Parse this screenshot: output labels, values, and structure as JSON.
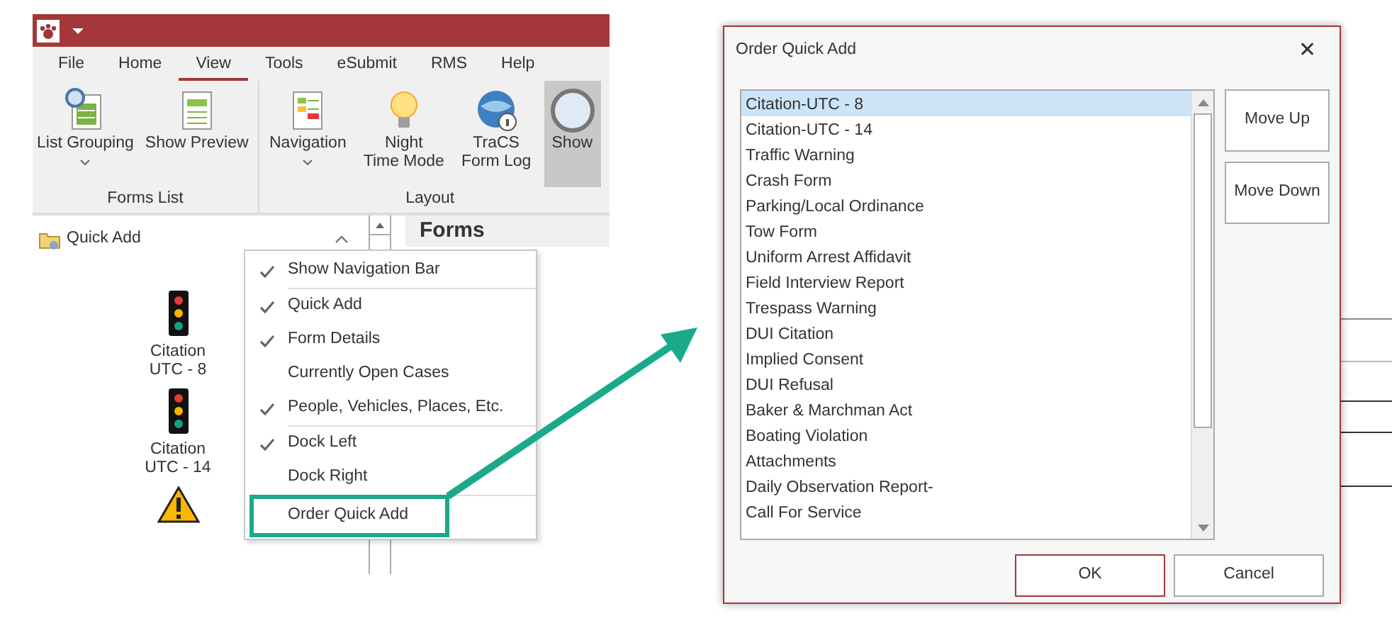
{
  "app": {
    "tabs": [
      {
        "label": "File",
        "selected": false
      },
      {
        "label": "Home",
        "selected": false
      },
      {
        "label": "View",
        "selected": true
      },
      {
        "label": "Tools",
        "selected": false
      },
      {
        "label": "eSubmit",
        "selected": false
      },
      {
        "label": "RMS",
        "selected": false
      },
      {
        "label": "Help",
        "selected": false
      }
    ],
    "ribbon_groups": [
      {
        "label": "Forms List",
        "buttons": [
          {
            "label": "List Grouping",
            "kind": "grouping",
            "dropdown": true,
            "pressed": false
          },
          {
            "label": "Show Preview",
            "kind": "preview",
            "dropdown": false,
            "pressed": false
          }
        ]
      },
      {
        "label": "Layout",
        "buttons": [
          {
            "label": "Navigation",
            "kind": "navigation",
            "dropdown": true,
            "pressed": false
          },
          {
            "label": "Night\nTime Mode",
            "kind": "bulb",
            "dropdown": false,
            "pressed": false
          },
          {
            "label": "TraCS\nForm Log",
            "kind": "globe",
            "dropdown": false,
            "pressed": false
          },
          {
            "label": "Show",
            "kind": "magnifier",
            "dropdown": false,
            "pressed": true
          }
        ]
      }
    ],
    "panel": {
      "title": "Quick Add",
      "items": [
        {
          "kind": "signal",
          "label": "Citation\nUTC - 8"
        },
        {
          "kind": "signal",
          "label": "Citation\nUTC - 14"
        },
        {
          "kind": "warning"
        }
      ]
    },
    "forms_header": "Forms",
    "context_menu": {
      "groups": [
        [
          {
            "label": "Show Navigation Bar",
            "checked": true,
            "callout": false
          }
        ],
        [
          {
            "label": "Quick Add",
            "checked": true,
            "callout": false
          },
          {
            "label": "Form Details",
            "checked": true,
            "callout": false
          },
          {
            "label": "Currently Open Cases",
            "checked": false,
            "callout": false
          },
          {
            "label": "People, Vehicles, Places, Etc.",
            "checked": true,
            "callout": false
          }
        ],
        [
          {
            "label": "Dock Left",
            "checked": true,
            "callout": false
          },
          {
            "label": "Dock Right",
            "checked": false,
            "callout": false
          }
        ],
        [
          {
            "label": "Order Quick Add",
            "checked": false,
            "callout": true
          }
        ]
      ]
    }
  },
  "dialog": {
    "title": "Order Quick Add",
    "close": "✕",
    "items": [
      {
        "label": "Citation-UTC - 8",
        "selected": true
      },
      {
        "label": "Citation-UTC - 14",
        "selected": false
      },
      {
        "label": "Traffic Warning",
        "selected": false
      },
      {
        "label": "Crash Form",
        "selected": false
      },
      {
        "label": "Parking/Local Ordinance",
        "selected": false
      },
      {
        "label": "Tow Form",
        "selected": false
      },
      {
        "label": "Uniform Arrest Affidavit",
        "selected": false
      },
      {
        "label": "Field Interview Report",
        "selected": false
      },
      {
        "label": "Trespass Warning",
        "selected": false
      },
      {
        "label": "DUI Citation",
        "selected": false
      },
      {
        "label": "Implied Consent",
        "selected": false
      },
      {
        "label": "DUI Refusal",
        "selected": false
      },
      {
        "label": "Baker & Marchman Act",
        "selected": false
      },
      {
        "label": "Boating Violation",
        "selected": false
      },
      {
        "label": "Attachments",
        "selected": false
      },
      {
        "label": "Daily Observation Report-",
        "selected": false
      },
      {
        "label": "Call For Service",
        "selected": false
      }
    ],
    "side_buttons": [
      "Move Up",
      "Move Down"
    ],
    "footer_buttons": [
      {
        "label": "OK",
        "default": true
      },
      {
        "label": "Cancel",
        "default": false
      }
    ]
  }
}
